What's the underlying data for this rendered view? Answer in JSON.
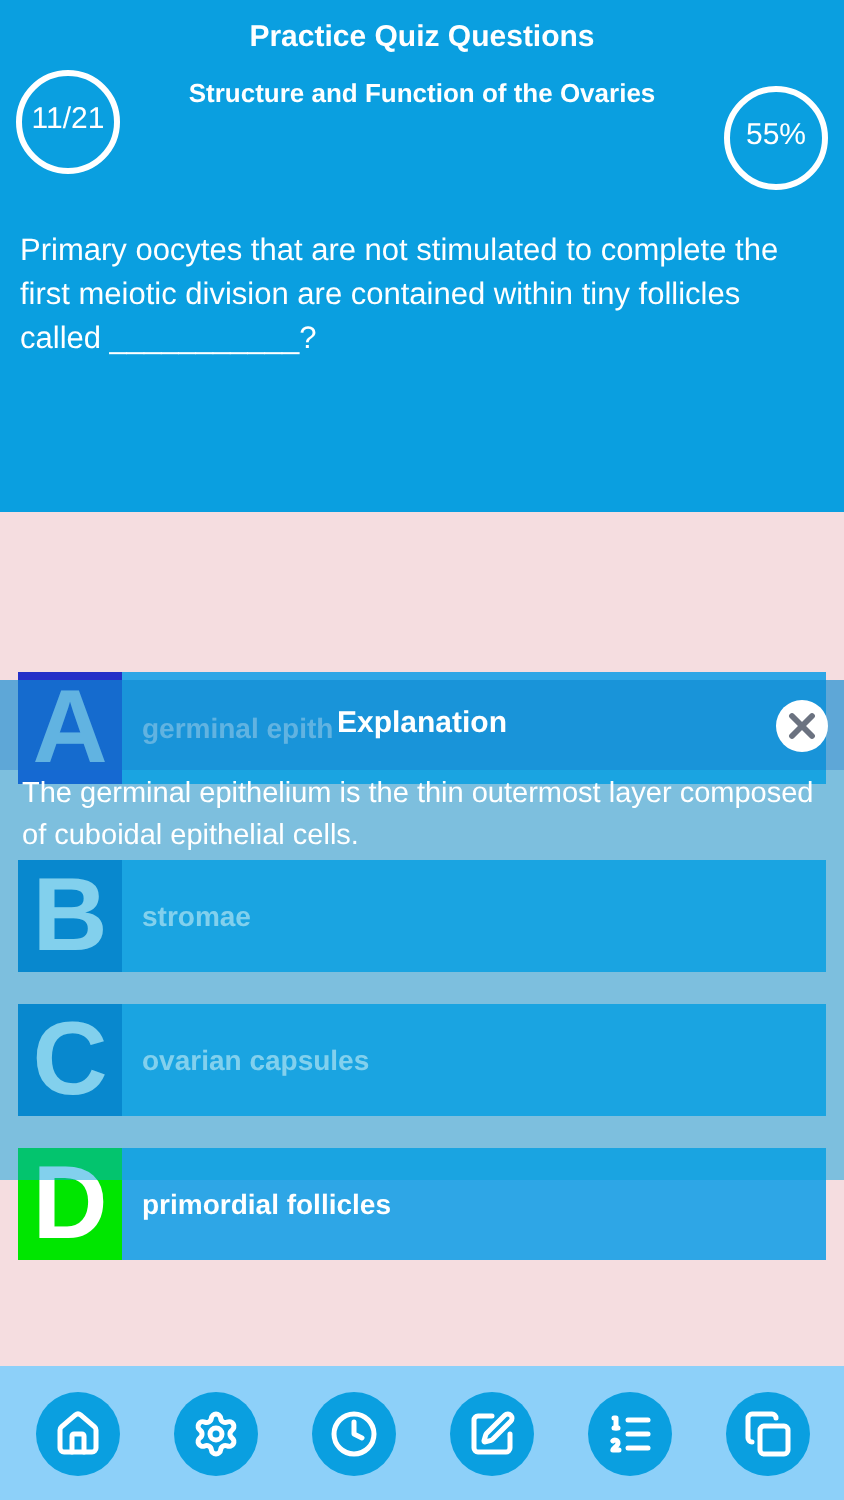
{
  "header": {
    "title": "Practice Quiz Questions",
    "subtitle": "Structure and Function of the Ovaries",
    "progress": "11/21",
    "score": "55%"
  },
  "question": "Primary oocytes that are not stimulated to complete the first meiotic division are contained within tiny follicles called ___________?",
  "answers": [
    {
      "letter": "A",
      "text": "germinal epith",
      "selected": true,
      "correct": false
    },
    {
      "letter": "B",
      "text": "stromae",
      "selected": false,
      "correct": false
    },
    {
      "letter": "C",
      "text": "ovarian capsules",
      "selected": false,
      "correct": false
    },
    {
      "letter": "D",
      "text": "primordial follicles",
      "selected": false,
      "correct": true
    }
  ],
  "explanation": {
    "title": "Explanation",
    "text": "The germinal epithelium is the thin outermost layer composed of cuboidal epithelial cells."
  },
  "nav": [
    {
      "kind": "home"
    },
    {
      "kind": "settings"
    },
    {
      "kind": "timer"
    },
    {
      "kind": "notes"
    },
    {
      "kind": "questions"
    },
    {
      "kind": "copy"
    }
  ]
}
